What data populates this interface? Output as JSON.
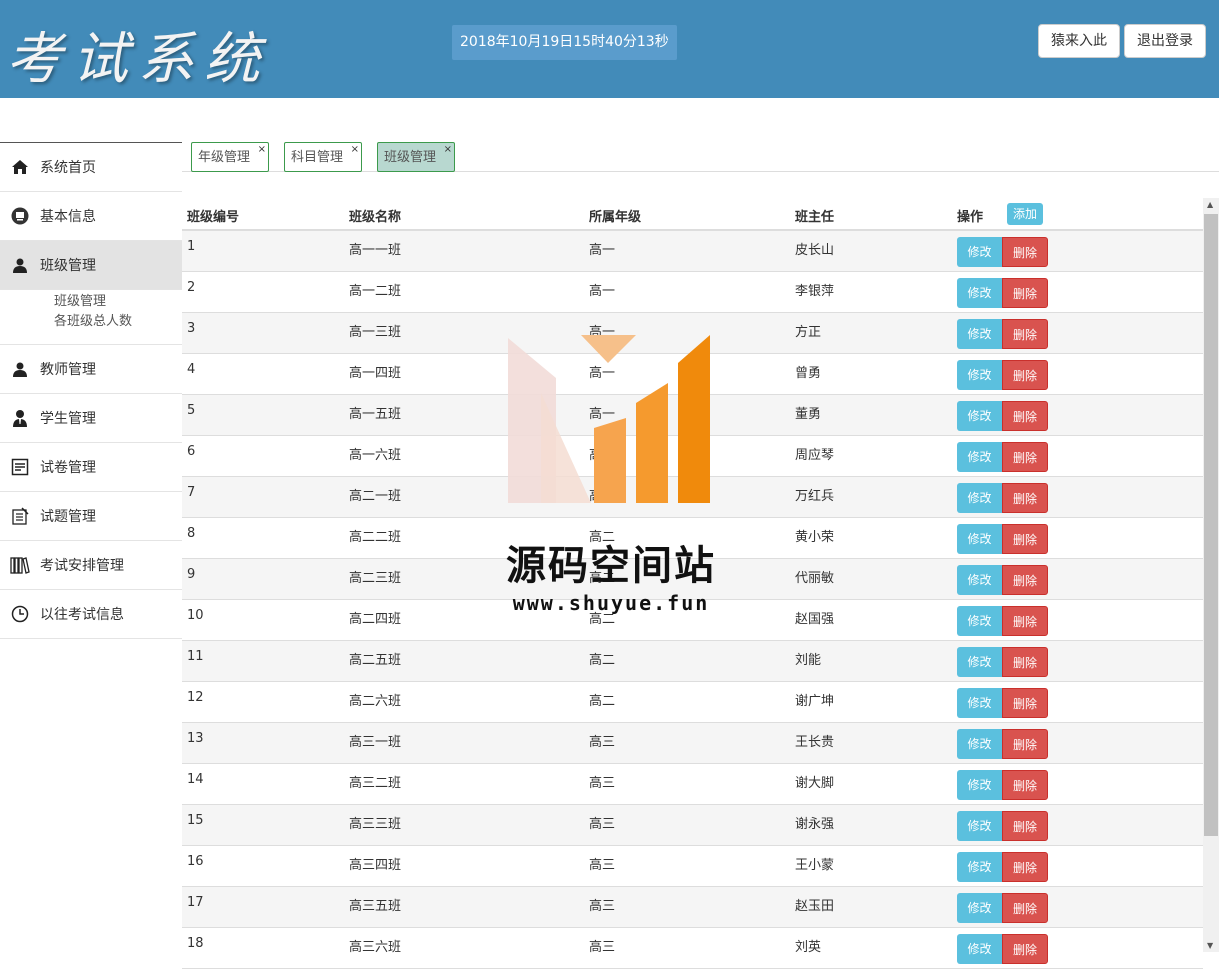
{
  "header": {
    "logo": "考试系统",
    "clock": "2018年10月19日15时40分13秒",
    "enter_label": "猿来入此",
    "logout_label": "退出登录"
  },
  "sidebar": {
    "items": [
      {
        "label": "系统首页",
        "icon": "home-icon"
      },
      {
        "label": "基本信息",
        "icon": "monitor-icon"
      },
      {
        "label": "班级管理",
        "icon": "user-icon"
      },
      {
        "label": "教师管理",
        "icon": "user-icon"
      },
      {
        "label": "学生管理",
        "icon": "user-tie-icon"
      },
      {
        "label": "试卷管理",
        "icon": "paper-icon"
      },
      {
        "label": "试题管理",
        "icon": "question-icon"
      },
      {
        "label": "考试安排管理",
        "icon": "books-icon"
      },
      {
        "label": "以往考试信息",
        "icon": "clock-icon"
      }
    ],
    "sub_items": [
      "班级管理",
      "各班级总人数"
    ]
  },
  "tabs": [
    {
      "label": "年级管理"
    },
    {
      "label": "科目管理"
    },
    {
      "label": "班级管理"
    }
  ],
  "table": {
    "headers": [
      "班级编号",
      "班级名称",
      "所属年级",
      "班主任",
      "操作"
    ],
    "add_label": "添加",
    "edit_label": "修改",
    "delete_label": "删除",
    "rows": [
      [
        "1",
        "高一一班",
        "高一",
        "皮长山"
      ],
      [
        "2",
        "高一二班",
        "高一",
        "李银萍"
      ],
      [
        "3",
        "高一三班",
        "高一",
        "方正"
      ],
      [
        "4",
        "高一四班",
        "高一",
        "曾勇"
      ],
      [
        "5",
        "高一五班",
        "高一",
        "董勇"
      ],
      [
        "6",
        "高一六班",
        "高一",
        "周应琴"
      ],
      [
        "7",
        "高二一班",
        "高二",
        "万红兵"
      ],
      [
        "8",
        "高二二班",
        "高二",
        "黄小荣"
      ],
      [
        "9",
        "高二三班",
        "高二",
        "代丽敏"
      ],
      [
        "10",
        "高二四班",
        "高二",
        "赵国强"
      ],
      [
        "11",
        "高二五班",
        "高二",
        "刘能"
      ],
      [
        "12",
        "高二六班",
        "高二",
        "谢广坤"
      ],
      [
        "13",
        "高三一班",
        "高三",
        "王长贵"
      ],
      [
        "14",
        "高三二班",
        "高三",
        "谢大脚"
      ],
      [
        "15",
        "高三三班",
        "高三",
        "谢永强"
      ],
      [
        "16",
        "高三四班",
        "高三",
        "王小蒙"
      ],
      [
        "17",
        "高三五班",
        "高三",
        "赵玉田"
      ],
      [
        "18",
        "高三六班",
        "高三",
        "刘英"
      ]
    ]
  },
  "watermark": {
    "title": "源码空间站",
    "url": "www.shuyue.fun"
  },
  "colors": {
    "header_bg": "#428bb9",
    "edit_btn": "#5bc0de",
    "delete_btn": "#d9534f",
    "tab_active": "#b8d8d0"
  }
}
